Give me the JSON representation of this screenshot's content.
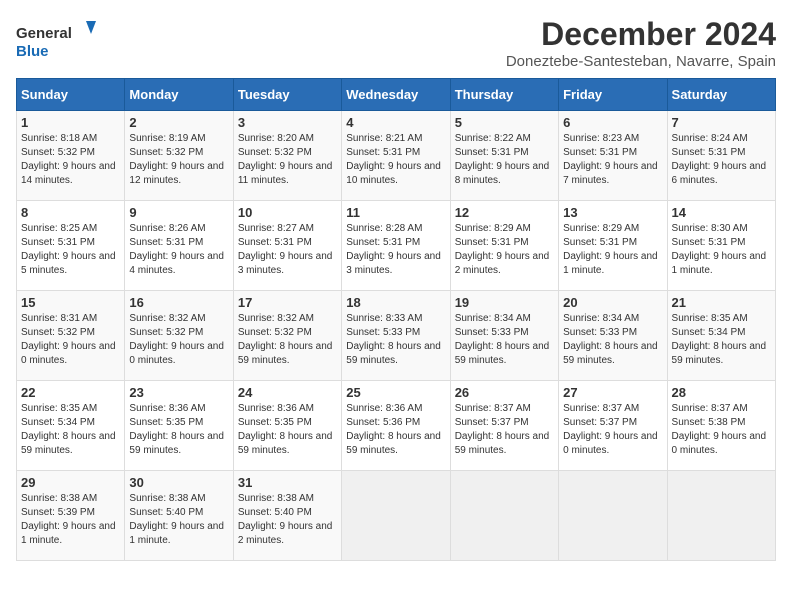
{
  "header": {
    "logo_line1": "General",
    "logo_line2": "Blue",
    "title": "December 2024",
    "location": "Doneztebe-Santesteban, Navarre, Spain"
  },
  "days_of_week": [
    "Sunday",
    "Monday",
    "Tuesday",
    "Wednesday",
    "Thursday",
    "Friday",
    "Saturday"
  ],
  "weeks": [
    [
      {
        "day": "1",
        "sunrise": "8:18 AM",
        "sunset": "5:32 PM",
        "daylight": "9 hours and 14 minutes."
      },
      {
        "day": "2",
        "sunrise": "8:19 AM",
        "sunset": "5:32 PM",
        "daylight": "9 hours and 12 minutes."
      },
      {
        "day": "3",
        "sunrise": "8:20 AM",
        "sunset": "5:32 PM",
        "daylight": "9 hours and 11 minutes."
      },
      {
        "day": "4",
        "sunrise": "8:21 AM",
        "sunset": "5:31 PM",
        "daylight": "9 hours and 10 minutes."
      },
      {
        "day": "5",
        "sunrise": "8:22 AM",
        "sunset": "5:31 PM",
        "daylight": "9 hours and 8 minutes."
      },
      {
        "day": "6",
        "sunrise": "8:23 AM",
        "sunset": "5:31 PM",
        "daylight": "9 hours and 7 minutes."
      },
      {
        "day": "7",
        "sunrise": "8:24 AM",
        "sunset": "5:31 PM",
        "daylight": "9 hours and 6 minutes."
      }
    ],
    [
      {
        "day": "8",
        "sunrise": "8:25 AM",
        "sunset": "5:31 PM",
        "daylight": "9 hours and 5 minutes."
      },
      {
        "day": "9",
        "sunrise": "8:26 AM",
        "sunset": "5:31 PM",
        "daylight": "9 hours and 4 minutes."
      },
      {
        "day": "10",
        "sunrise": "8:27 AM",
        "sunset": "5:31 PM",
        "daylight": "9 hours and 3 minutes."
      },
      {
        "day": "11",
        "sunrise": "8:28 AM",
        "sunset": "5:31 PM",
        "daylight": "9 hours and 3 minutes."
      },
      {
        "day": "12",
        "sunrise": "8:29 AM",
        "sunset": "5:31 PM",
        "daylight": "9 hours and 2 minutes."
      },
      {
        "day": "13",
        "sunrise": "8:29 AM",
        "sunset": "5:31 PM",
        "daylight": "9 hours and 1 minute."
      },
      {
        "day": "14",
        "sunrise": "8:30 AM",
        "sunset": "5:31 PM",
        "daylight": "9 hours and 1 minute."
      }
    ],
    [
      {
        "day": "15",
        "sunrise": "8:31 AM",
        "sunset": "5:32 PM",
        "daylight": "9 hours and 0 minutes."
      },
      {
        "day": "16",
        "sunrise": "8:32 AM",
        "sunset": "5:32 PM",
        "daylight": "9 hours and 0 minutes."
      },
      {
        "day": "17",
        "sunrise": "8:32 AM",
        "sunset": "5:32 PM",
        "daylight": "8 hours and 59 minutes."
      },
      {
        "day": "18",
        "sunrise": "8:33 AM",
        "sunset": "5:33 PM",
        "daylight": "8 hours and 59 minutes."
      },
      {
        "day": "19",
        "sunrise": "8:34 AM",
        "sunset": "5:33 PM",
        "daylight": "8 hours and 59 minutes."
      },
      {
        "day": "20",
        "sunrise": "8:34 AM",
        "sunset": "5:33 PM",
        "daylight": "8 hours and 59 minutes."
      },
      {
        "day": "21",
        "sunrise": "8:35 AM",
        "sunset": "5:34 PM",
        "daylight": "8 hours and 59 minutes."
      }
    ],
    [
      {
        "day": "22",
        "sunrise": "8:35 AM",
        "sunset": "5:34 PM",
        "daylight": "8 hours and 59 minutes."
      },
      {
        "day": "23",
        "sunrise": "8:36 AM",
        "sunset": "5:35 PM",
        "daylight": "8 hours and 59 minutes."
      },
      {
        "day": "24",
        "sunrise": "8:36 AM",
        "sunset": "5:35 PM",
        "daylight": "8 hours and 59 minutes."
      },
      {
        "day": "25",
        "sunrise": "8:36 AM",
        "sunset": "5:36 PM",
        "daylight": "8 hours and 59 minutes."
      },
      {
        "day": "26",
        "sunrise": "8:37 AM",
        "sunset": "5:37 PM",
        "daylight": "8 hours and 59 minutes."
      },
      {
        "day": "27",
        "sunrise": "8:37 AM",
        "sunset": "5:37 PM",
        "daylight": "9 hours and 0 minutes."
      },
      {
        "day": "28",
        "sunrise": "8:37 AM",
        "sunset": "5:38 PM",
        "daylight": "9 hours and 0 minutes."
      }
    ],
    [
      {
        "day": "29",
        "sunrise": "8:38 AM",
        "sunset": "5:39 PM",
        "daylight": "9 hours and 1 minute."
      },
      {
        "day": "30",
        "sunrise": "8:38 AM",
        "sunset": "5:40 PM",
        "daylight": "9 hours and 1 minute."
      },
      {
        "day": "31",
        "sunrise": "8:38 AM",
        "sunset": "5:40 PM",
        "daylight": "9 hours and 2 minutes."
      },
      null,
      null,
      null,
      null
    ]
  ]
}
